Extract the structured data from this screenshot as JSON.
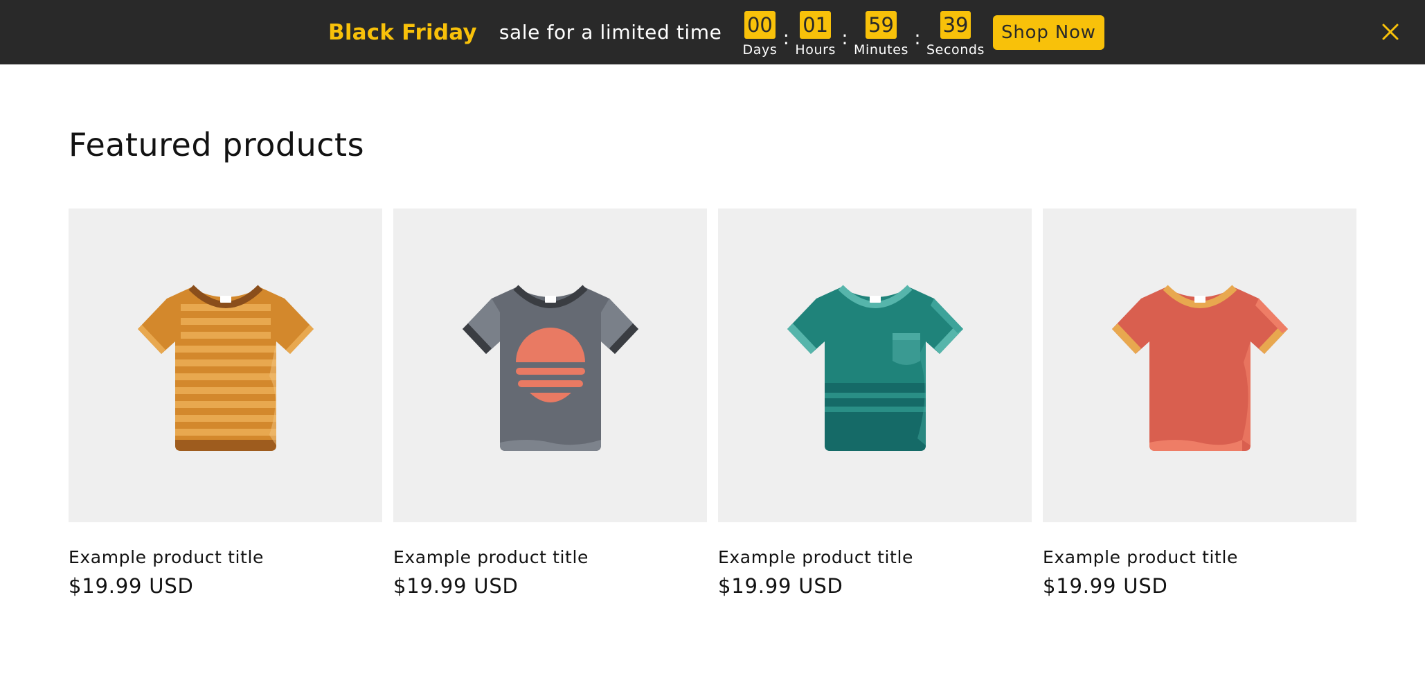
{
  "announcement": {
    "title": "Black Friday",
    "text": "sale for a limited time",
    "countdown": [
      {
        "value": "00",
        "label": "Days"
      },
      {
        "value": "01",
        "label": "Hours"
      },
      {
        "value": "59",
        "label": "Minutes"
      },
      {
        "value": "39",
        "label": "Seconds"
      }
    ],
    "separator": ":",
    "cta_label": "Shop Now",
    "close_icon": "close-icon",
    "accent_color": "#f8c10a",
    "bar_color": "#292929"
  },
  "featured": {
    "title": "Featured products",
    "products": [
      {
        "title": "Example product title",
        "price": "$19.99 USD",
        "image_icon": "tshirt-striped-orange-icon"
      },
      {
        "title": "Example product title",
        "price": "$19.99 USD",
        "image_icon": "tshirt-gray-sunset-icon"
      },
      {
        "title": "Example product title",
        "price": "$19.99 USD",
        "image_icon": "tshirt-teal-pocket-icon"
      },
      {
        "title": "Example product title",
        "price": "$19.99 USD",
        "image_icon": "tshirt-red-icon"
      }
    ]
  }
}
